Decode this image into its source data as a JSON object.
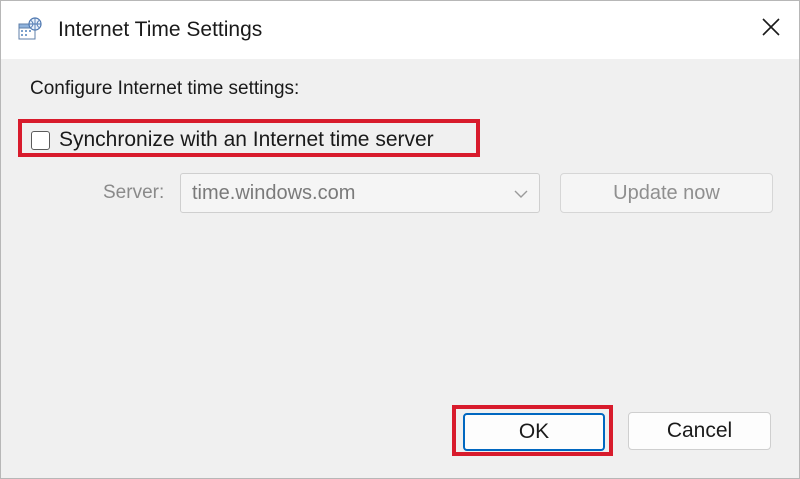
{
  "window": {
    "title": "Internet Time Settings",
    "icon": "date-time-globe-icon"
  },
  "content": {
    "section_label": "Configure Internet time settings:",
    "sync_checkbox": {
      "label": "Synchronize with an Internet time server",
      "checked": false
    },
    "server": {
      "label": "Server:",
      "value": "time.windows.com",
      "enabled": false
    },
    "update_button_label": "Update now"
  },
  "footer": {
    "ok_label": "OK",
    "cancel_label": "Cancel"
  },
  "annotations": {
    "highlight_color": "#d81b2c",
    "highlighted_targets": [
      "sync-checkbox",
      "ok-button"
    ]
  },
  "colors": {
    "accent": "#0067c0",
    "disabled_text": "#8a8a8a"
  }
}
